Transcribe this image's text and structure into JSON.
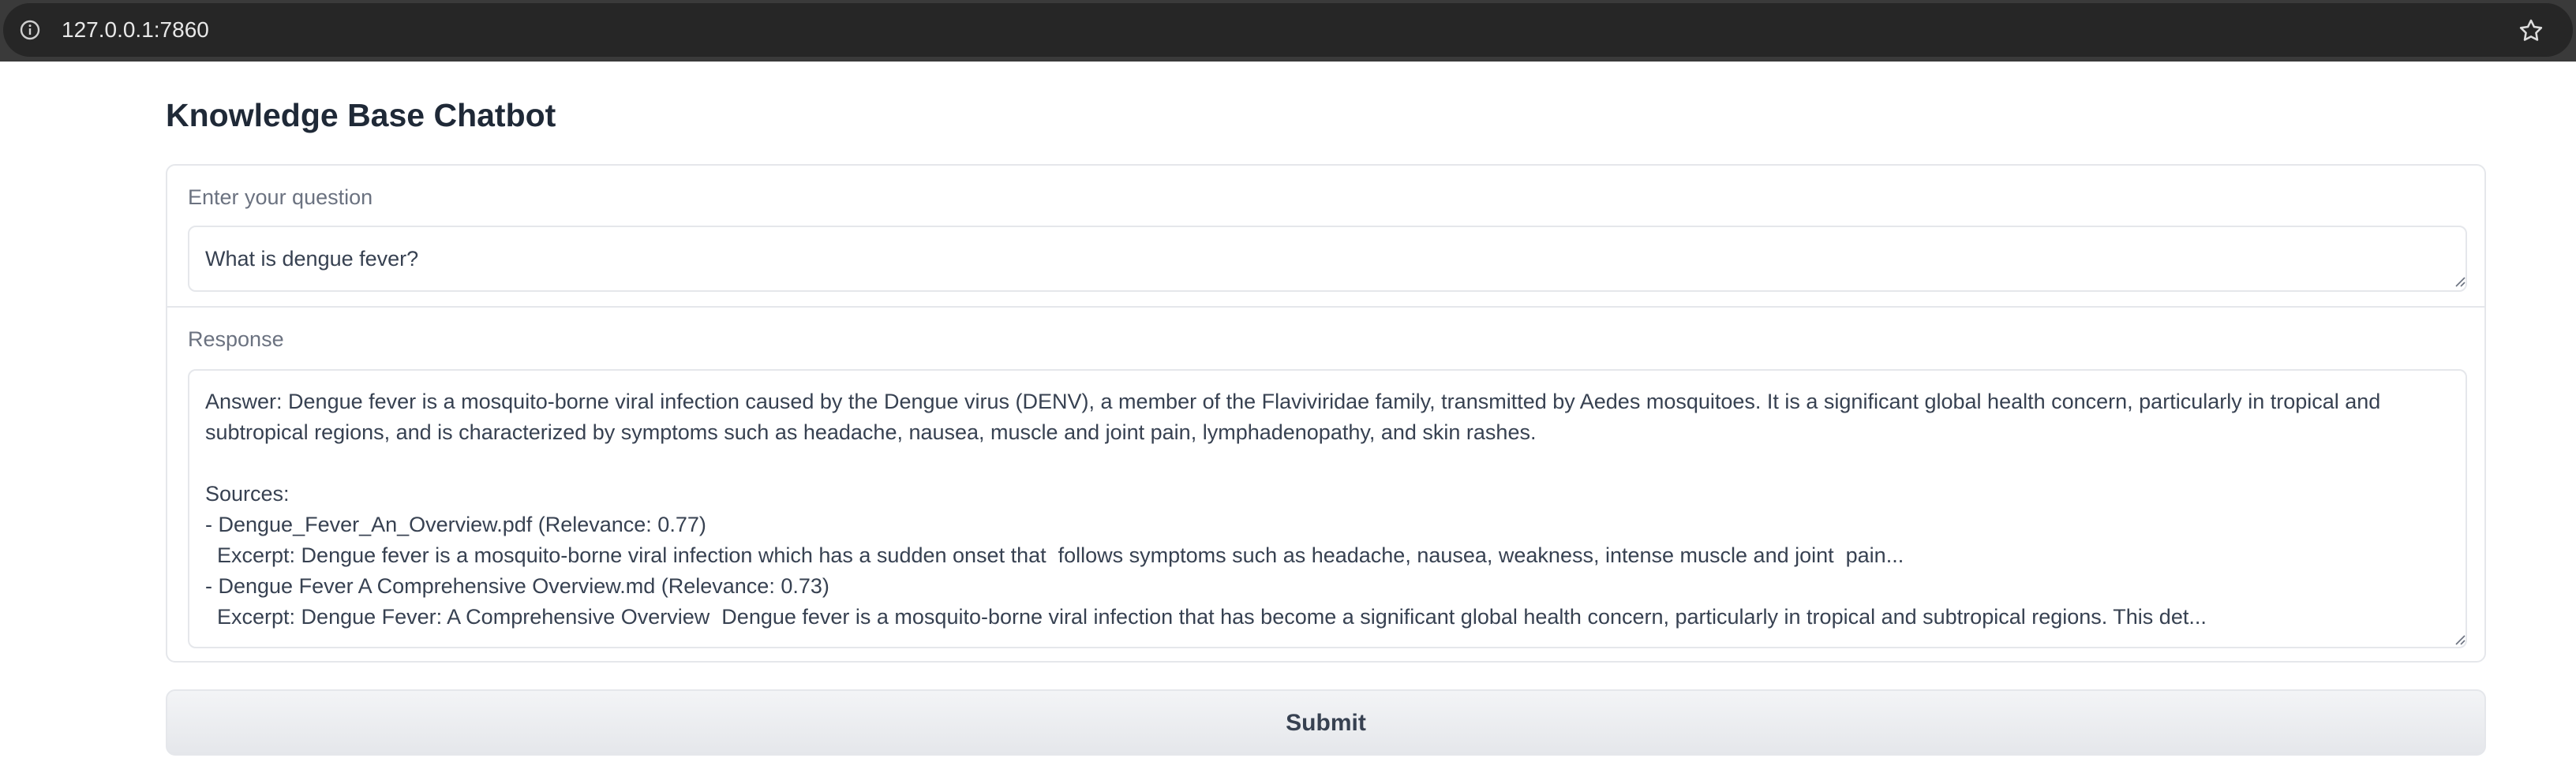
{
  "browser": {
    "url": "127.0.0.1:7860",
    "info_icon": "info-icon",
    "bookmark_icon": "star-icon"
  },
  "page": {
    "title": "Knowledge Base Chatbot"
  },
  "question": {
    "label": "Enter your question",
    "value": "What is dengue fever?"
  },
  "response": {
    "label": "Response",
    "value": "Answer: Dengue fever is a mosquito-borne viral infection caused by the Dengue virus (DENV), a member of the Flaviviridae family, transmitted by Aedes mosquitoes. It is a significant global health concern, particularly in tropical and subtropical regions, and is characterized by symptoms such as headache, nausea, muscle and joint pain, lymphadenopathy, and skin rashes.\n\nSources:\n- Dengue_Fever_An_Overview.pdf (Relevance: 0.77)\n  Excerpt: Dengue fever is a mosquito-borne viral infection which has a sudden onset that  follows symptoms such as headache, nausea, weakness, intense muscle and joint  pain...\n- Dengue Fever A Comprehensive Overview.md (Relevance: 0.73)\n  Excerpt: Dengue Fever: A Comprehensive Overview  Dengue fever is a mosquito-borne viral infection that has become a significant global health concern, particularly in tropical and subtropical regions. This det..."
  },
  "submit": {
    "label": "Submit"
  }
}
